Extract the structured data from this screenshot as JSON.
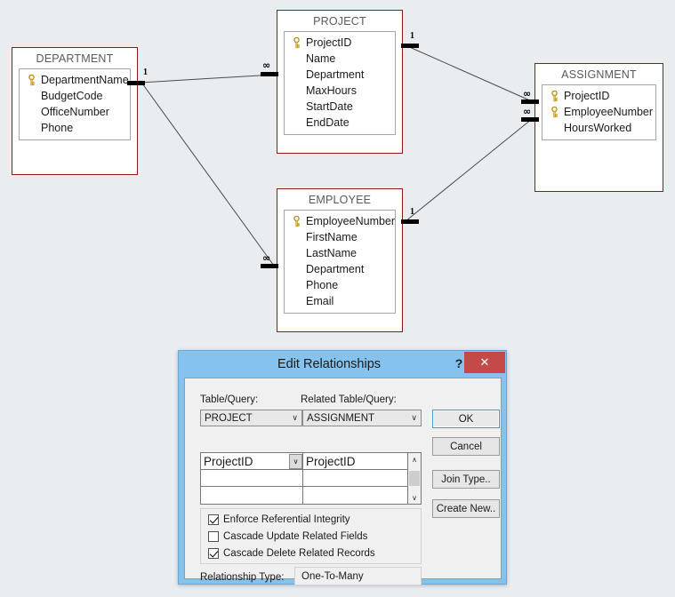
{
  "canvas": {
    "background_color": "#e9edf0",
    "tables": [
      {
        "name": "DEPARTMENT",
        "fields": [
          {
            "name": "DepartmentName",
            "key": true
          },
          {
            "name": "BudgetCode",
            "key": false
          },
          {
            "name": "OfficeNumber",
            "key": false
          },
          {
            "name": "Phone",
            "key": false
          }
        ]
      },
      {
        "name": "PROJECT",
        "fields": [
          {
            "name": "ProjectID",
            "key": true
          },
          {
            "name": "Name",
            "key": false
          },
          {
            "name": "Department",
            "key": false
          },
          {
            "name": "MaxHours",
            "key": false
          },
          {
            "name": "StartDate",
            "key": false
          },
          {
            "name": "EndDate",
            "key": false
          }
        ]
      },
      {
        "name": "EMPLOYEE",
        "fields": [
          {
            "name": "EmployeeNumber",
            "key": true
          },
          {
            "name": "FirstName",
            "key": false
          },
          {
            "name": "LastName",
            "key": false
          },
          {
            "name": "Department",
            "key": false
          },
          {
            "name": "Phone",
            "key": false
          },
          {
            "name": "Email",
            "key": false
          }
        ]
      },
      {
        "name": "ASSIGNMENT",
        "fields": [
          {
            "name": "ProjectID",
            "key": true
          },
          {
            "name": "EmployeeNumber",
            "key": true
          },
          {
            "name": "HoursWorked",
            "key": false
          }
        ]
      }
    ],
    "relationships": [
      {
        "from": "DEPARTMENT",
        "to": "PROJECT",
        "from_cardinality": "1",
        "to_cardinality": "∞"
      },
      {
        "from": "DEPARTMENT",
        "to": "EMPLOYEE",
        "from_cardinality": "1",
        "to_cardinality": "∞"
      },
      {
        "from": "PROJECT",
        "to": "ASSIGNMENT",
        "from_cardinality": "1",
        "to_cardinality": "∞"
      },
      {
        "from": "EMPLOYEE",
        "to": "ASSIGNMENT",
        "from_cardinality": "1",
        "to_cardinality": "∞"
      }
    ],
    "cardinality_one": "1",
    "cardinality_many": "∞"
  },
  "dialog": {
    "title": "Edit Relationships",
    "help_label": "?",
    "close_label": "✕",
    "titlebar_color": "#85c2ed",
    "close_button_color": "#c44a4a",
    "left_label": "Table/Query:",
    "right_label": "Related Table/Query:",
    "left_table": "PROJECT",
    "right_table": "ASSIGNMENT",
    "dropdown_arrow": "∨",
    "scroll_up_arrow": "∧",
    "scroll_down_arrow": "∨",
    "grid": {
      "left_column": [
        "ProjectID",
        "",
        ""
      ],
      "right_column": [
        "ProjectID",
        "",
        ""
      ]
    },
    "options": [
      {
        "label": "Enforce Referential Integrity",
        "checked": true
      },
      {
        "label": "Cascade Update Related Fields",
        "checked": false
      },
      {
        "label": "Cascade Delete Related Records",
        "checked": true
      }
    ],
    "relationship_type_label": "Relationship Type:",
    "relationship_type_value": "One-To-Many",
    "buttons": [
      {
        "label": "OK",
        "focused": true
      },
      {
        "label": "Cancel",
        "focused": false
      },
      {
        "label": "Join Type..",
        "focused": false
      },
      {
        "label": "Create New..",
        "focused": false
      }
    ]
  }
}
